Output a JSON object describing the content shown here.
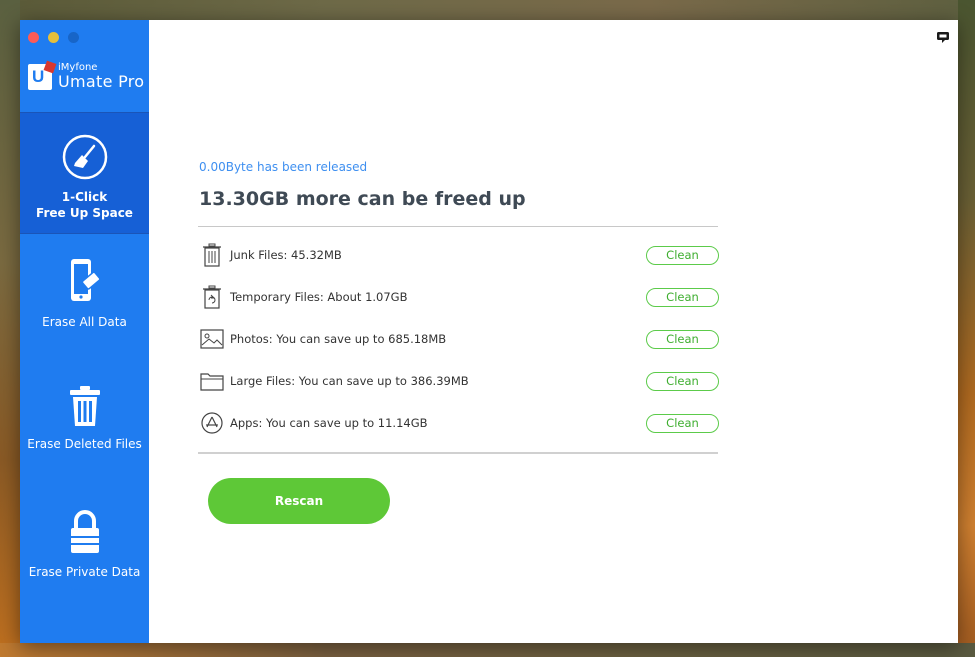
{
  "app": {
    "brand_small": "iMyfone",
    "brand_big": "Umate Pro"
  },
  "sidebar": {
    "items": [
      {
        "line1": "1-Click",
        "line2": "Free Up Space",
        "icon": "broom-icon",
        "active": true
      },
      {
        "label": "Erase All Data",
        "icon": "phone-eraser-icon"
      },
      {
        "label": "Erase Deleted Files",
        "icon": "trash-icon"
      },
      {
        "label": "Erase Private Data",
        "icon": "lock-icon"
      }
    ]
  },
  "main": {
    "released_value": "0.00Byte",
    "released_text": "has been released",
    "freed_value": "13.30GB",
    "freed_text": "more can be freed up",
    "rows": [
      {
        "label": "Junk Files: 45.32MB",
        "icon": "trash-can-icon",
        "button": "Clean"
      },
      {
        "label": "Temporary Files: About 1.07GB",
        "icon": "temp-files-icon",
        "button": "Clean"
      },
      {
        "label": "Photos: You can save up to 685.18MB",
        "icon": "photo-icon",
        "button": "Clean"
      },
      {
        "label": "Large Files: You can save up to 386.39MB",
        "icon": "folder-icon",
        "button": "Clean"
      },
      {
        "label": "Apps: You can save up to 11.14GB",
        "icon": "app-store-icon",
        "button": "Clean"
      }
    ],
    "rescan_label": "Rescan"
  },
  "colors": {
    "sidebar": "#1f7cf0",
    "sidebar_active": "#1660d6",
    "accent_green": "#5ec837",
    "link_blue": "#3e8ff0"
  }
}
